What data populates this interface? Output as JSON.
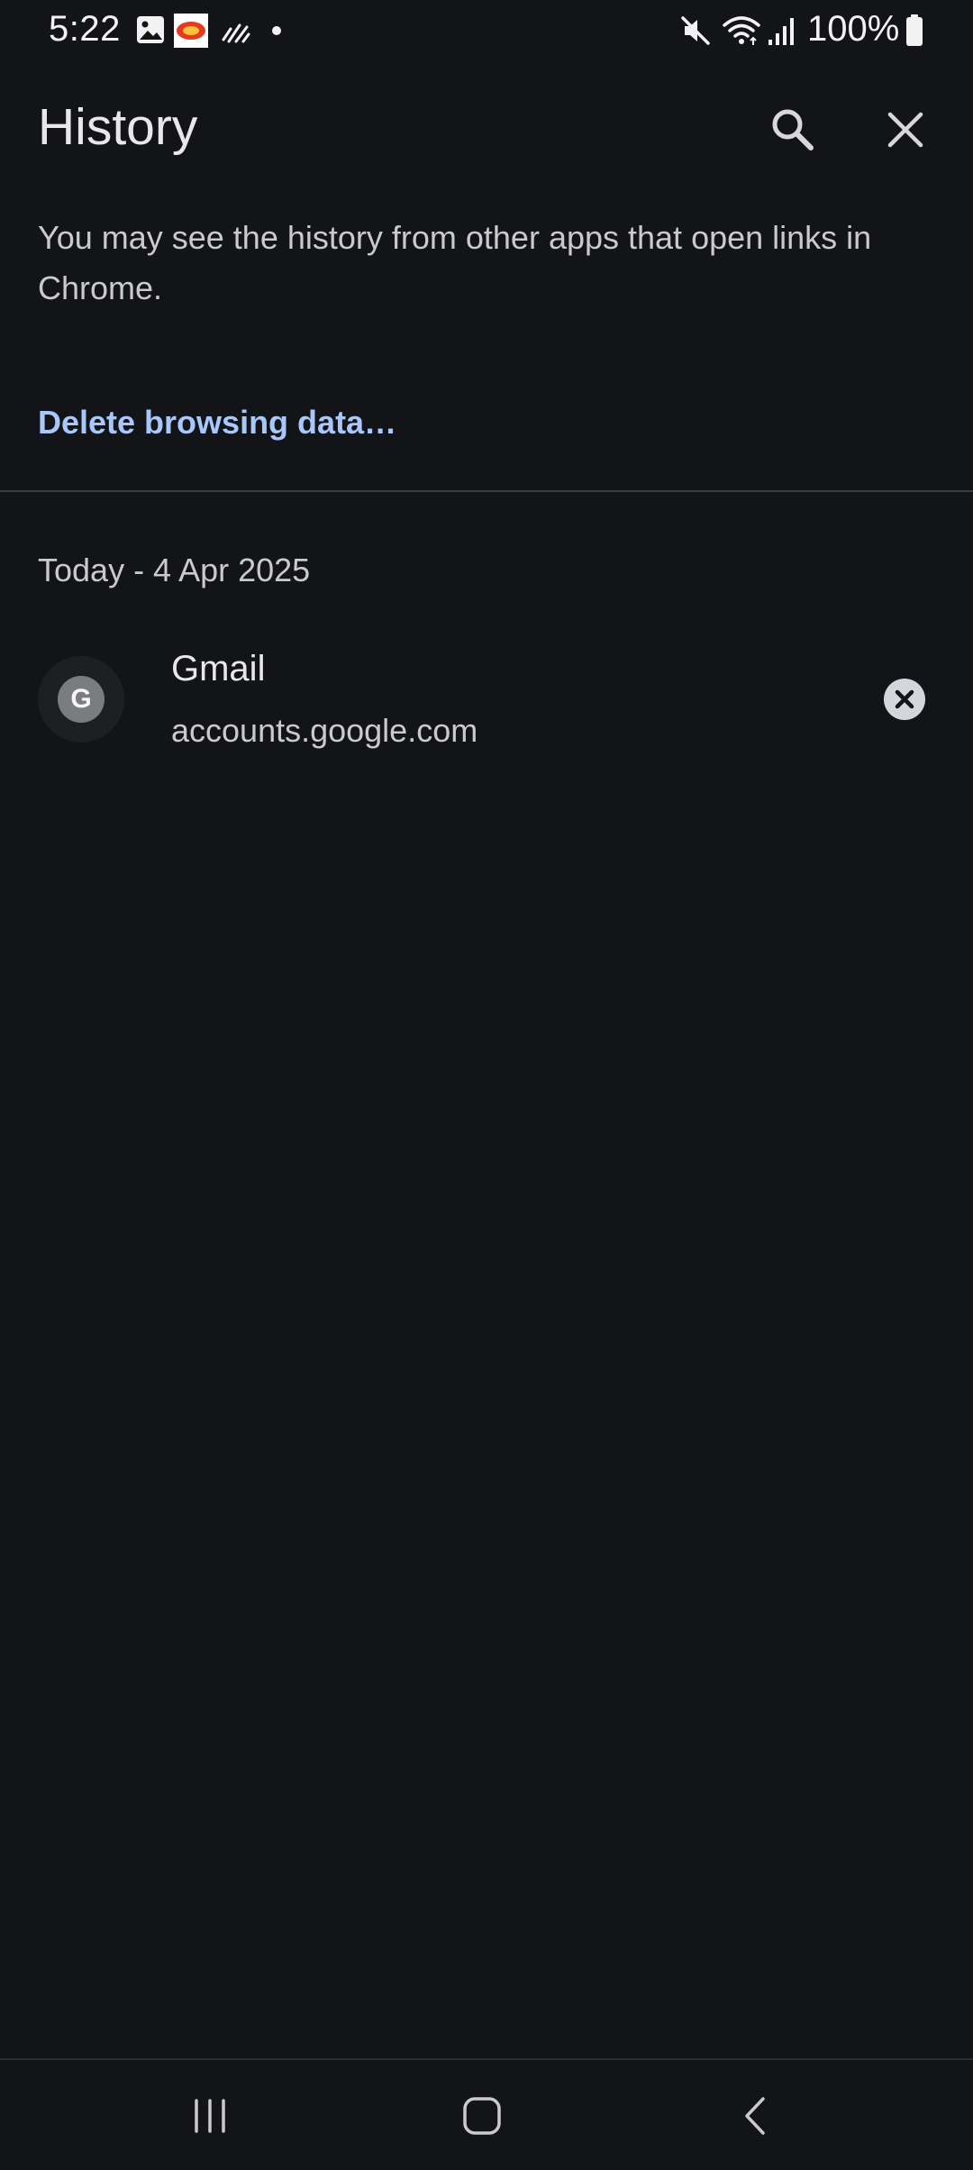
{
  "status_bar": {
    "time": "5:22",
    "battery": "100%",
    "icons": [
      "gallery-icon",
      "app-notification-icon",
      "signal-activity-icon",
      "dot-icon",
      "mute-icon",
      "wifi-icon",
      "cell-signal-icon",
      "battery-icon"
    ]
  },
  "toolbar": {
    "title": "History",
    "search_icon": "search-icon",
    "close_icon": "close-icon"
  },
  "info": {
    "text": "You may see the history from other apps that open links in Chrome."
  },
  "delete_link": "Delete browsing data…",
  "history": {
    "groups": [
      {
        "date": "Today - 4 Apr 2025",
        "items": [
          {
            "favicon_letter": "G",
            "title": "Gmail",
            "url": "accounts.google.com"
          }
        ]
      }
    ]
  },
  "colors": {
    "background": "#131417",
    "link": "#a8c7fa",
    "text_primary": "#e8e8ec",
    "text_secondary": "#c9c9cf"
  },
  "nav_bar": {
    "recents_icon": "recents-icon",
    "home_icon": "home-icon",
    "back_icon": "back-icon"
  }
}
